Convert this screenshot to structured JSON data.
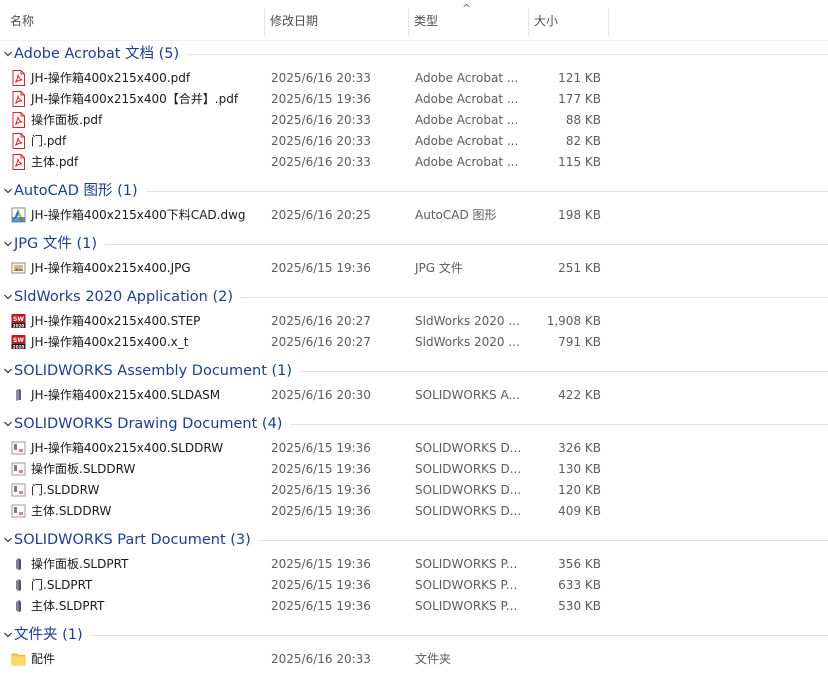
{
  "header": {
    "col_name": "名称",
    "col_date": "修改日期",
    "col_type": "类型",
    "col_size": "大小",
    "sort_indicator": "^"
  },
  "groups": [
    {
      "title": "Adobe Acrobat 文档 (5)",
      "icon": "pdf-icon",
      "files": [
        {
          "name": "JH-操作箱400x215x400.pdf",
          "date": "2025/6/16 20:33",
          "type": "Adobe Acrobat ...",
          "size": "121 KB"
        },
        {
          "name": "JH-操作箱400x215x400【合并】.pdf",
          "date": "2025/6/15 19:36",
          "type": "Adobe Acrobat ...",
          "size": "177 KB"
        },
        {
          "name": "操作面板.pdf",
          "date": "2025/6/16 20:33",
          "type": "Adobe Acrobat ...",
          "size": "88 KB"
        },
        {
          "name": "门.pdf",
          "date": "2025/6/16 20:33",
          "type": "Adobe Acrobat ...",
          "size": "82 KB"
        },
        {
          "name": "主体.pdf",
          "date": "2025/6/16 20:33",
          "type": "Adobe Acrobat ...",
          "size": "115 KB"
        }
      ]
    },
    {
      "title": "AutoCAD 图形 (1)",
      "icon": "dwg-icon",
      "files": [
        {
          "name": "JH-操作箱400x215x400下料CAD.dwg",
          "date": "2025/6/16 20:25",
          "type": "AutoCAD 图形",
          "size": "198 KB"
        }
      ]
    },
    {
      "title": "JPG 文件 (1)",
      "icon": "jpg-icon",
      "files": [
        {
          "name": "JH-操作箱400x215x400.JPG",
          "date": "2025/6/15 19:36",
          "type": "JPG 文件",
          "size": "251 KB"
        }
      ]
    },
    {
      "title": "SldWorks 2020 Application (2)",
      "icon": "sldworks-icon",
      "files": [
        {
          "name": "JH-操作箱400x215x400.STEP",
          "date": "2025/6/16 20:27",
          "type": "SldWorks 2020 ...",
          "size": "1,908 KB"
        },
        {
          "name": "JH-操作箱400x215x400.x_t",
          "date": "2025/6/16 20:27",
          "type": "SldWorks 2020 ...",
          "size": "791 KB"
        }
      ]
    },
    {
      "title": "SOLIDWORKS Assembly Document (1)",
      "icon": "assembly-icon",
      "files": [
        {
          "name": "JH-操作箱400x215x400.SLDASM",
          "date": "2025/6/16 20:30",
          "type": "SOLIDWORKS A...",
          "size": "422 KB"
        }
      ]
    },
    {
      "title": "SOLIDWORKS Drawing Document (4)",
      "icon": "drawing-icon",
      "files": [
        {
          "name": "JH-操作箱400x215x400.SLDDRW",
          "date": "2025/6/15 19:36",
          "type": "SOLIDWORKS D...",
          "size": "326 KB"
        },
        {
          "name": "操作面板.SLDDRW",
          "date": "2025/6/15 19:36",
          "type": "SOLIDWORKS D...",
          "size": "130 KB"
        },
        {
          "name": "门.SLDDRW",
          "date": "2025/6/15 19:36",
          "type": "SOLIDWORKS D...",
          "size": "120 KB"
        },
        {
          "name": "主体.SLDDRW",
          "date": "2025/6/15 19:36",
          "type": "SOLIDWORKS D...",
          "size": "409 KB"
        }
      ]
    },
    {
      "title": "SOLIDWORKS Part Document (3)",
      "icon": "part-icon",
      "files": [
        {
          "name": "操作面板.SLDPRT",
          "date": "2025/6/15 19:36",
          "type": "SOLIDWORKS P...",
          "size": "356 KB"
        },
        {
          "name": "门.SLDPRT",
          "date": "2025/6/15 19:36",
          "type": "SOLIDWORKS P...",
          "size": "633 KB"
        },
        {
          "name": "主体.SLDPRT",
          "date": "2025/6/15 19:36",
          "type": "SOLIDWORKS P...",
          "size": "530 KB"
        }
      ]
    },
    {
      "title": "文件夹 (1)",
      "icon": "folder-icon",
      "files": [
        {
          "name": "配件",
          "date": "2025/6/16 20:33",
          "type": "文件夹",
          "size": ""
        }
      ]
    }
  ],
  "colors": {
    "group_title": "#1e3d8f",
    "pdf_red": "#d9252a",
    "folder_yellow": "#f5c842"
  }
}
